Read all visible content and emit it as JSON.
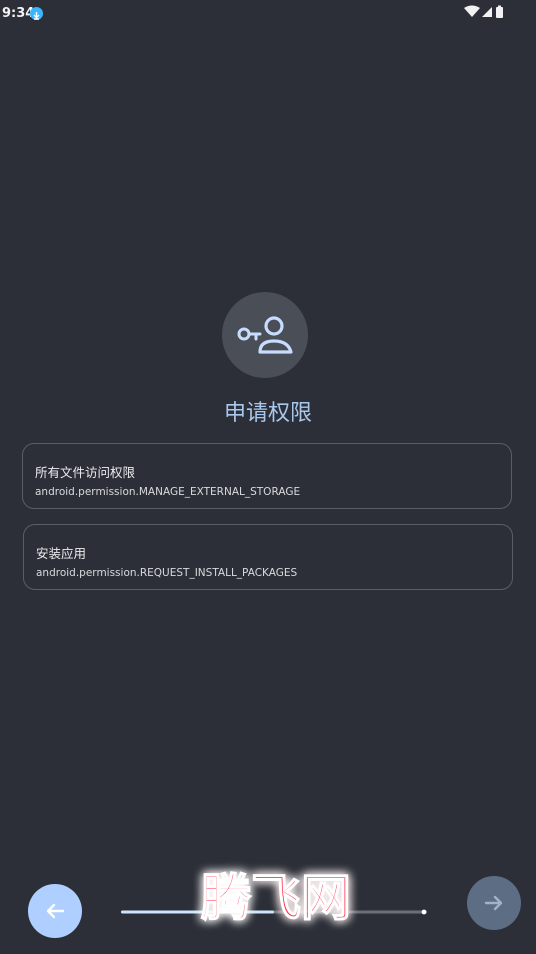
{
  "status_bar": {
    "time": "9:34",
    "icons": [
      "download-icon",
      "wifi-icon",
      "signal-icon",
      "battery-icon"
    ]
  },
  "header": {
    "icon": "key-person-icon",
    "title": "申请权限"
  },
  "permissions": [
    {
      "title": "所有文件访问权限",
      "subtitle": "android.permission.MANAGE_EXTERNAL_STORAGE"
    },
    {
      "title": "安装应用",
      "subtitle": "android.permission.REQUEST_INSTALL_PACKAGES"
    }
  ],
  "navigation": {
    "back_icon": "arrow-left-icon",
    "next_icon": "arrow-right-icon",
    "progress": 0.5
  },
  "watermark_text": "腾飞网",
  "colors": {
    "background": "#2c2f37",
    "accent": "#aecfff",
    "title": "#a9c8ee",
    "watermark": "#ff2b4a"
  }
}
